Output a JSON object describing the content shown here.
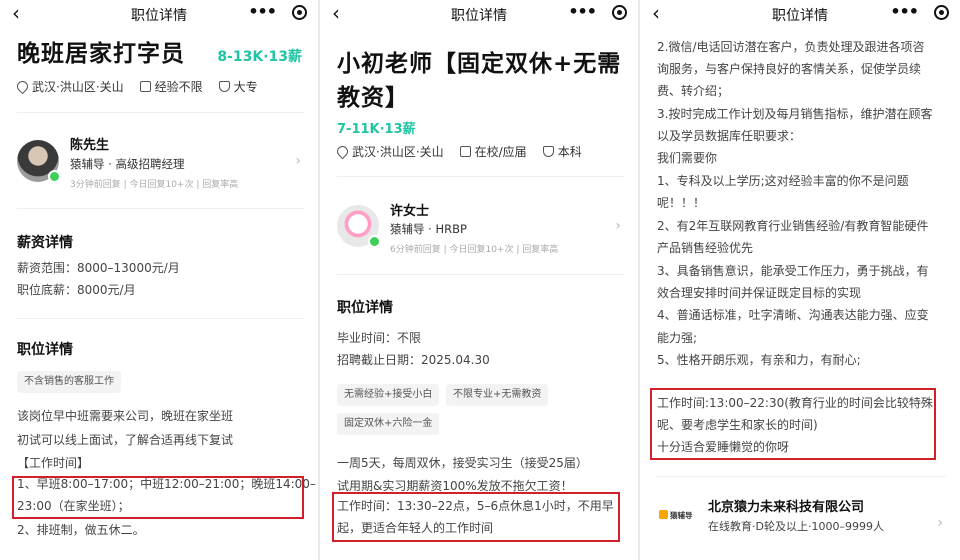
{
  "p1": {
    "nav_title": "职位详情",
    "job_title": "晚班居家打字员",
    "salary": "8-13K·13薪",
    "location": "武汉·洪山区·关山",
    "experience": "经验不限",
    "education": "大专",
    "recruiter": {
      "name": "陈先生",
      "role": "猿辅导 · 高级招聘经理",
      "activity": "3分钟前回复 | 今日回复10+次 | 回复率高"
    },
    "salary_section": {
      "title": "薪资详情",
      "range": "薪资范围：8000–13000元/月",
      "base": "职位底薪：8000元/月"
    },
    "detail_section": {
      "title": "职位详情",
      "tag": "不含销售的客服工作",
      "lines": [
        "该岗位早中班需要来公司，晚班在家坐班",
        "初试可以线上面试，了解合适再线下复试",
        "【工作时间】"
      ],
      "boxed": [
        "1、早班8:00–17:00；中班12:00–21:00；晚班14:00–",
        "23:00（在家坐班）；"
      ],
      "after": "2、排班制，做五休二。"
    }
  },
  "p2": {
    "nav_title": "职位详情",
    "job_title_lines": [
      "小初老师【固定双休+无需",
      "教资】"
    ],
    "salary": "7-11K·13薪",
    "location": "武汉·洪山区·关山",
    "experience": "在校/应届",
    "education": "本科",
    "recruiter": {
      "name": "许女士",
      "role": "猿辅导 · HRBP",
      "activity": "6分钟前回复 | 今日回复10+次 | 回复率高"
    },
    "detail_section": {
      "title": "职位详情",
      "graduation": "毕业时间：不限",
      "deadline": "招聘截止日期：2025.04.30",
      "tags": [
        "无需经验+接受小白",
        "不限专业+无需教资",
        "固定双休+六险一金"
      ],
      "lines": [
        "一周5天，每周双休，接受实习生（接受25届）",
        "试用期&实习期薪资100%发放不拖欠工资！"
      ],
      "boxed": [
        "工作时间：13:30–22点，5–6点休息1小时，不用早",
        "起，更适合年轻人的工作时间"
      ]
    }
  },
  "p3": {
    "nav_title": "职位详情",
    "lines": [
      "2.微信/电话回访潜在客户，负责处理及跟进各项咨",
      "询服务，与客户保持良好的客情关系，促使学员续",
      "费、转介绍；",
      "3.按时完成工作计划及每月销售指标，维护潜在顾客",
      "以及学员数据库任职要求：",
      "我们需要你",
      "1、专科及以上学历;这对经验丰富的你不是问题",
      "呢！！！",
      "2、有2年互联网教育行业销售经验/有教育智能硬件",
      "产品销售经验优先",
      "3、具备销售意识，能承受工作压力，勇于挑战，有",
      "效合理安排时间并保证既定目标的实现",
      "4、普通话标准，吐字清晰、沟通表达能力强、应变",
      "能力强;",
      "5、性格开朗乐观，有亲和力，有耐心;"
    ],
    "boxed": [
      "工作时间:13:00–22:30(教育行业的时间会比较特殊",
      "呢、要考虑学生和家长的时间)",
      "十分适合爱睡懒觉的你呀"
    ],
    "company": {
      "logo_text": "猿辅导",
      "name": "北京猿力未来科技有限公司",
      "info": "在线教育·D轮及以上·1000–9999人"
    }
  }
}
